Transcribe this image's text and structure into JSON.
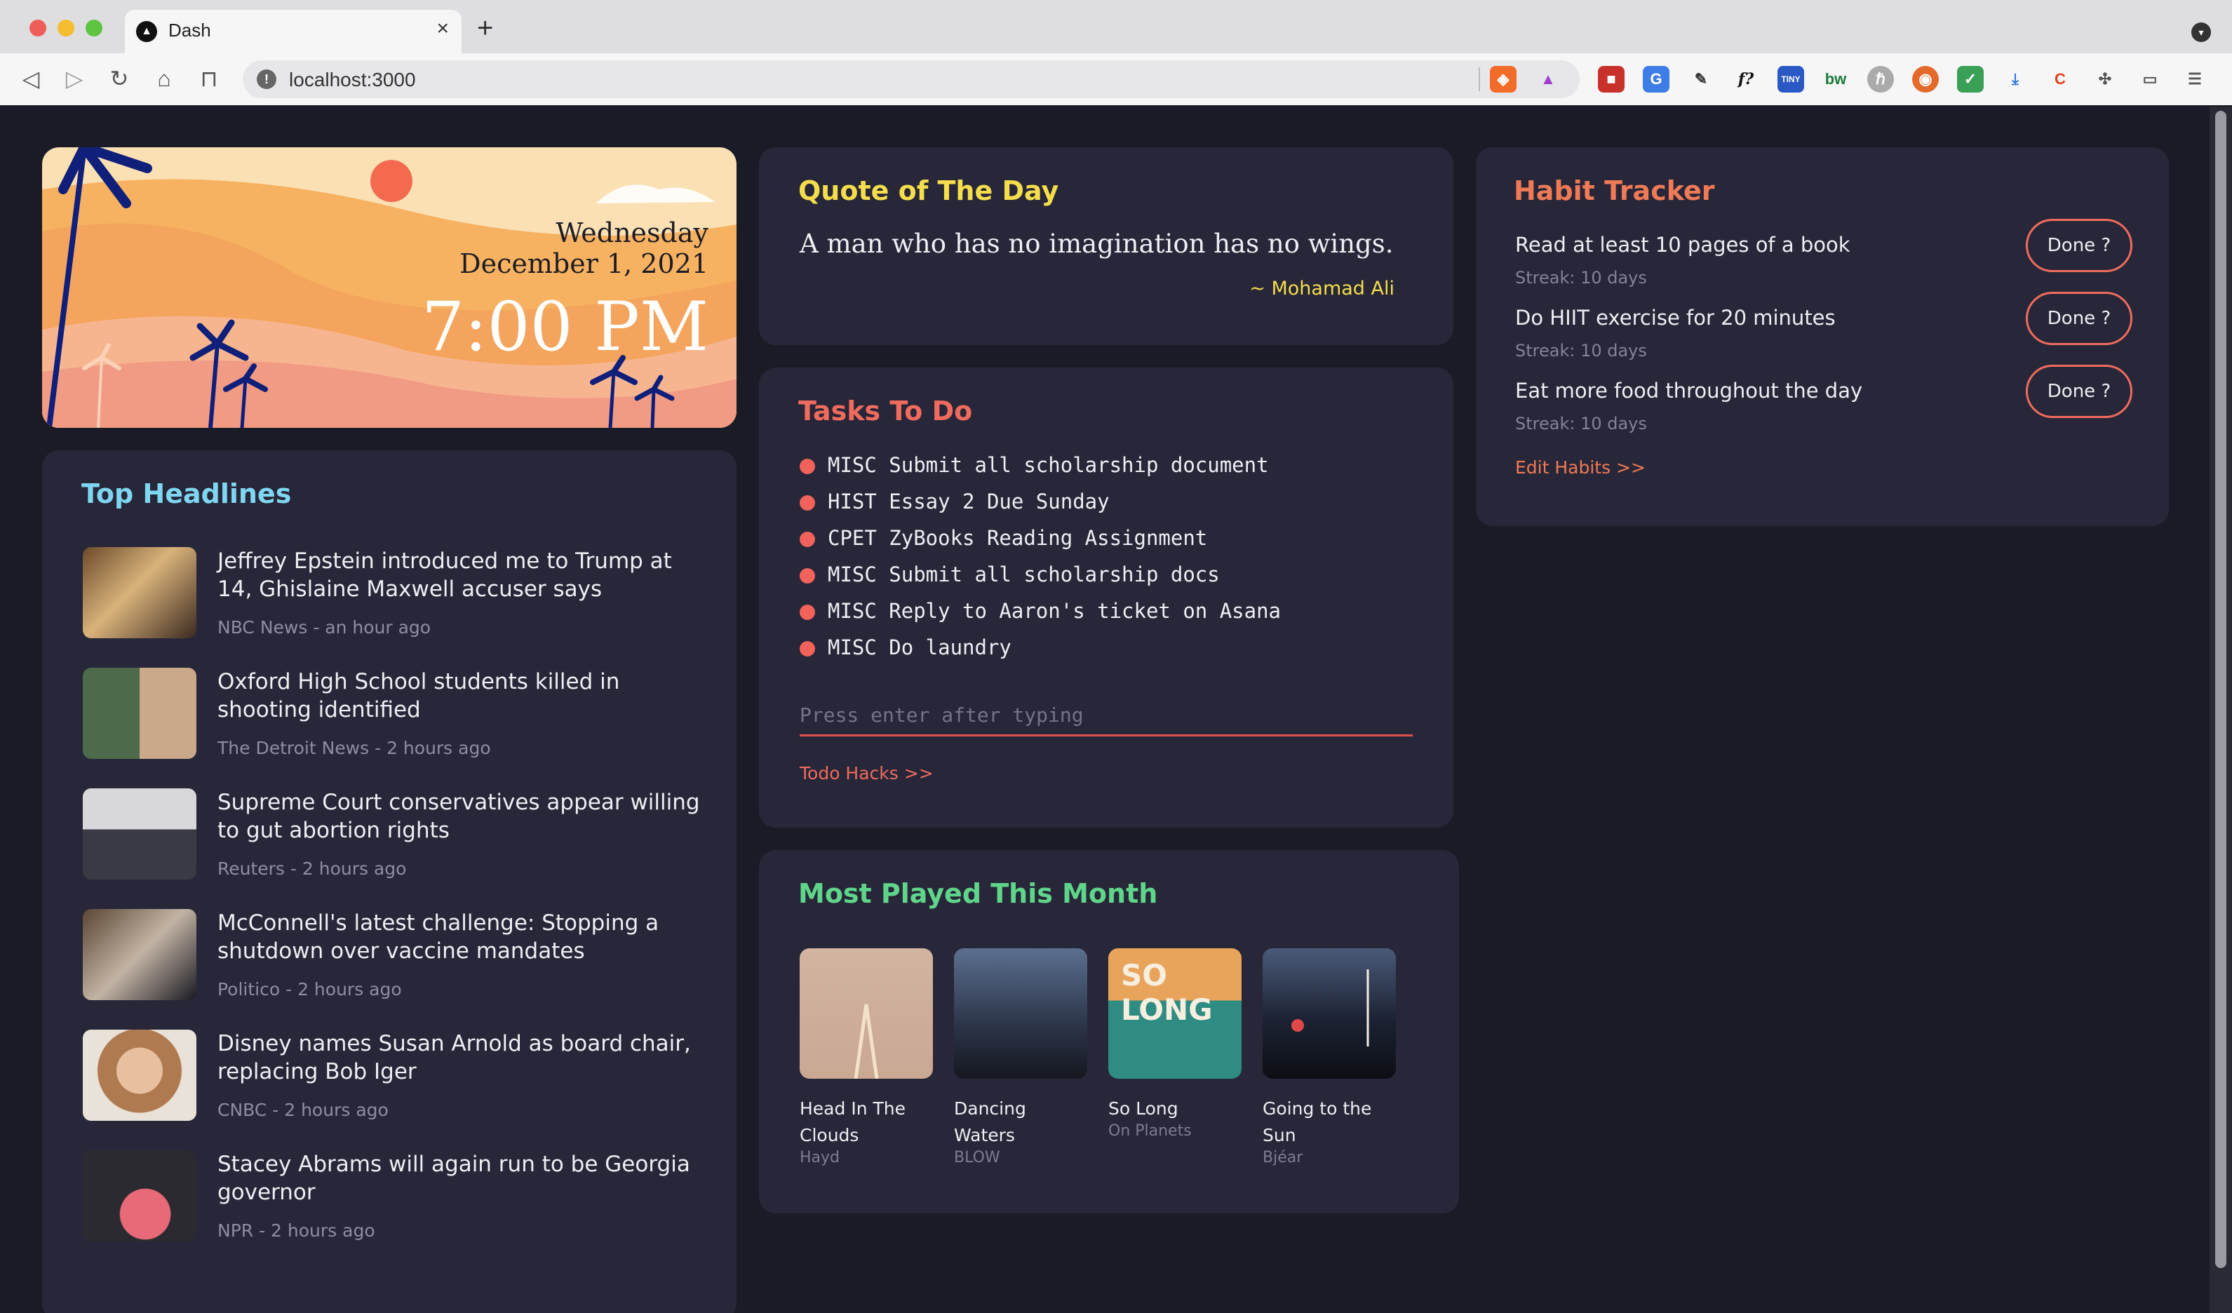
{
  "browser": {
    "tab_title": "Dash",
    "url": "localhost:3000",
    "extensions": [
      "brave-shield-icon",
      "brave-rewards-icon",
      "bookmark-red-icon",
      "translate-icon",
      "color-picker-icon",
      "font-finder-icon",
      "tinyurl-icon",
      "bw-icon",
      "ext-badge-icon",
      "duckduckgo-icon",
      "shield-check-icon",
      "download-icon",
      "cssviewer-icon",
      "puzzle-icon",
      "wallet-icon",
      "menu-icon"
    ]
  },
  "hero": {
    "day": "Wednesday",
    "date": "December 1, 2021",
    "time": "7:00 PM"
  },
  "headlines": {
    "title": "Top Headlines",
    "items": [
      {
        "title": "Jeffrey Epstein introduced me to Trump at 14, Ghislaine Maxwell accuser says",
        "meta": "NBC News - an hour ago"
      },
      {
        "title": "Oxford High School students killed in shooting identified",
        "meta": "The Detroit News - 2 hours ago"
      },
      {
        "title": "Supreme Court conservatives appear willing to gut abortion rights",
        "meta": "Reuters - 2 hours ago"
      },
      {
        "title": "McConnell's latest challenge: Stopping a shutdown over vaccine mandates",
        "meta": "Politico - 2 hours ago"
      },
      {
        "title": "Disney names Susan Arnold as board chair, replacing Bob Iger",
        "meta": "CNBC - 2 hours ago"
      },
      {
        "title": "Stacey Abrams will again run to be Georgia governor",
        "meta": "NPR - 2 hours ago"
      }
    ]
  },
  "quote": {
    "title": "Quote of The Day",
    "text": "A man who has no imagination has no wings.",
    "author": "~ Mohamad Ali"
  },
  "tasks": {
    "title": "Tasks To Do",
    "items": [
      "MISC Submit all scholarship document",
      "HIST Essay 2 Due Sunday",
      "CPET ZyBooks Reading Assignment",
      "MISC Submit all scholarship docs",
      "MISC Reply to Aaron's ticket on Asana",
      "MISC Do laundry"
    ],
    "input_placeholder": "Press enter after typing",
    "link": "Todo Hacks >>"
  },
  "music": {
    "title": "Most Played This Month",
    "albums": [
      {
        "title": "Head In The Clouds",
        "artist": "Hayd"
      },
      {
        "title": "Dancing Waters",
        "artist": "BLOW"
      },
      {
        "title": "So Long",
        "artist": "On Planets",
        "cover_text": "SO LONG"
      },
      {
        "title": "Going to the Sun",
        "artist": "Bjéar"
      }
    ]
  },
  "habits": {
    "title": "Habit Tracker",
    "items": [
      {
        "name": "Read at least 10 pages of a book",
        "streak": "Streak: 10 days",
        "button": "Done ?"
      },
      {
        "name": "Do HIIT exercise for 20 minutes",
        "streak": "Streak: 10 days",
        "button": "Done ?"
      },
      {
        "name": "Eat more food throughout the day",
        "streak": "Streak: 10 days",
        "button": "Done ?"
      }
    ],
    "link": "Edit Habits >>"
  },
  "colors": {
    "background": "#1b1b27",
    "card": "#272739",
    "headline_accent": "#7fd6f0",
    "quote_accent": "#f5dd4b",
    "task_accent": "#f06b5d",
    "music_accent": "#5fd58a",
    "habit_accent": "#f07a55"
  }
}
